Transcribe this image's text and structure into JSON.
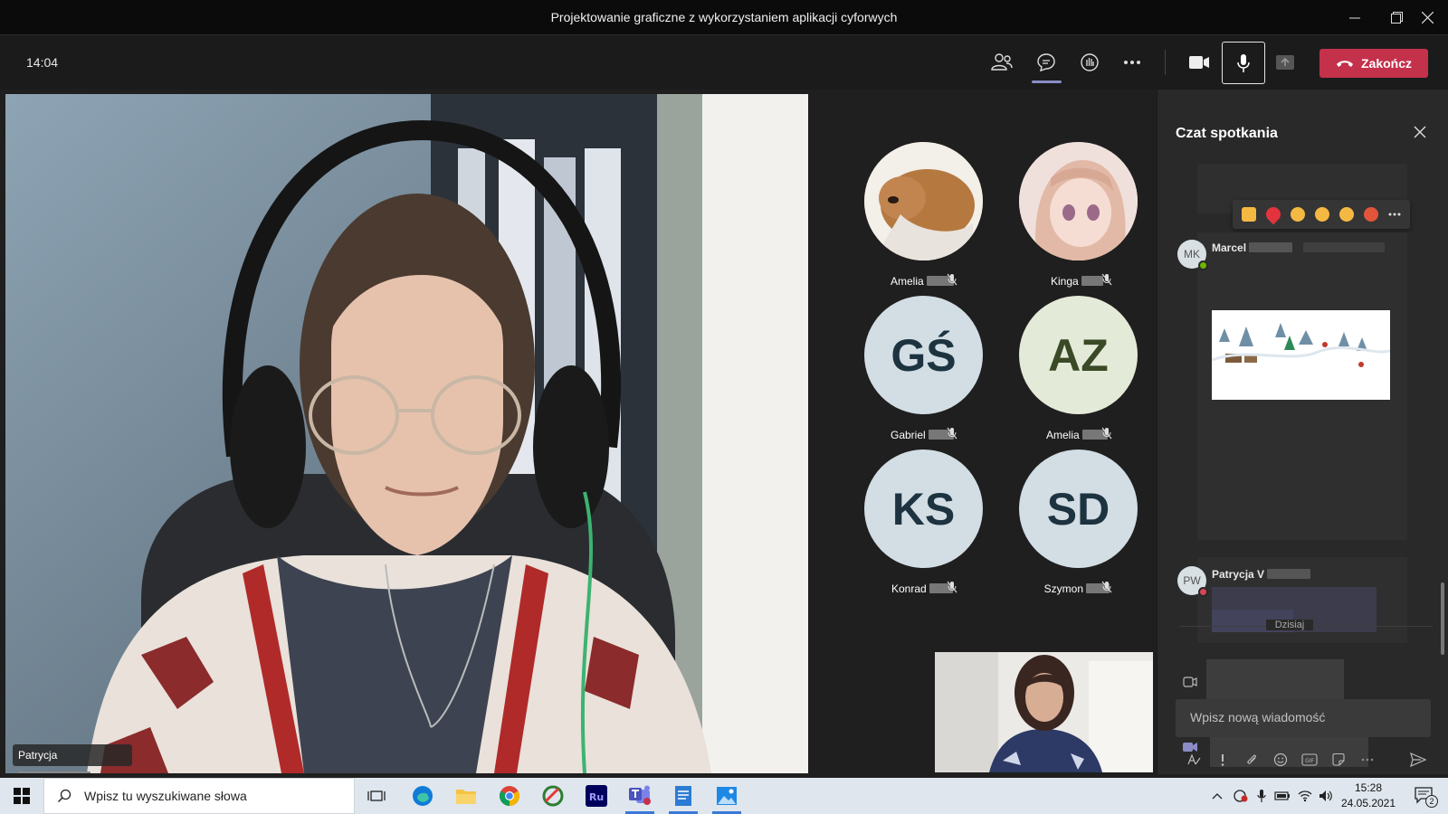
{
  "window": {
    "title": "Projektowanie graficzne z wykorzystaniem aplikacji cyforwych"
  },
  "toolbar": {
    "elapsed": "14:04",
    "end_label": "Zakończ"
  },
  "main_video": {
    "name": "Patrycja"
  },
  "participants": [
    {
      "name": "Amelia",
      "initials": "",
      "bg": "#c9a079",
      "muted": true
    },
    {
      "name": "Kinga",
      "initials": "",
      "bg": "#e8d3cf",
      "muted": true
    },
    {
      "name": "Gabriel",
      "initials": "GŚ",
      "bg": "#d2dde4",
      "fg": "#1e3340",
      "muted": true
    },
    {
      "name": "Amelia",
      "initials": "AZ",
      "bg": "#e4ead8",
      "fg": "#3a4a26",
      "muted": true
    },
    {
      "name": "Konrad",
      "initials": "KS",
      "bg": "#d2dde4",
      "fg": "#1e3340",
      "muted": true
    },
    {
      "name": "Szymon",
      "initials": "SD",
      "bg": "#d2dde4",
      "fg": "#1e3340",
      "muted": true
    }
  ],
  "chat": {
    "title": "Czat spotkania",
    "messages": [
      {
        "initials": "MK",
        "sender": "Marcel",
        "status_color": "#6bb700"
      },
      {
        "initials": "PW",
        "sender": "Patrycja V",
        "status_color": "#d74654"
      }
    ],
    "day_divider": "Dzisiaj",
    "compose_placeholder": "Wpisz nową wiadomość"
  },
  "taskbar": {
    "search_placeholder": "Wpisz tu wyszukiwane słowa",
    "time": "15:28",
    "date": "24.05.2021",
    "notification_count": "2"
  },
  "colors": {
    "end_call": "#c4314b",
    "accent": "#8b8cc7"
  }
}
